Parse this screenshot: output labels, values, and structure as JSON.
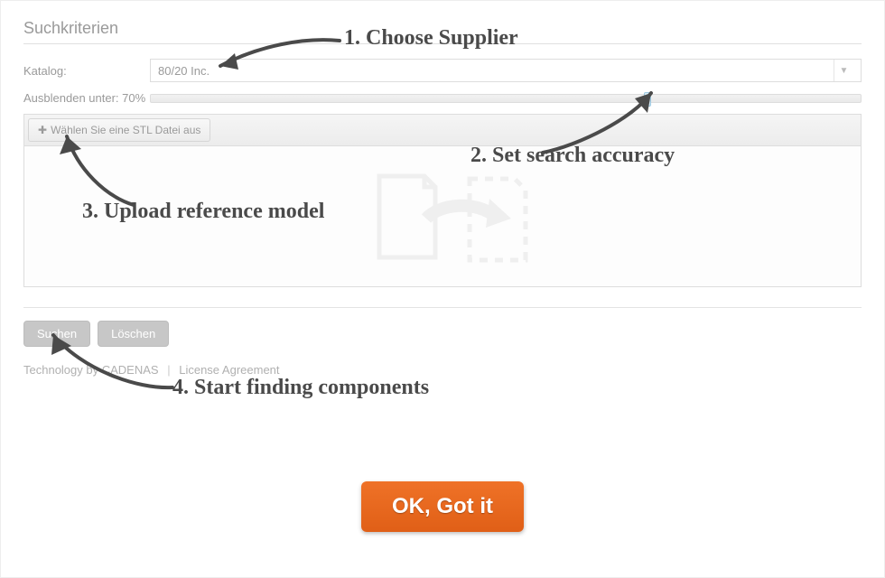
{
  "panel": {
    "title": "Suchkriterien",
    "catalog_label": "Katalog:",
    "catalog_value": "80/20 Inc.",
    "threshold_label": "Ausblenden unter:",
    "threshold_value": "70%",
    "upload_button": "Wählen Sie eine STL Datei aus",
    "search_button": "Suchen",
    "clear_button": "Löschen"
  },
  "footer": {
    "tech": "Technology by CADENAS",
    "license": "License Agreement"
  },
  "cta": {
    "ok": "OK, Got it"
  },
  "annotations": {
    "a1": "1. Choose Supplier",
    "a2": "2. Set search accuracy",
    "a3": "3. Upload reference model",
    "a4": "4. Start finding components"
  }
}
